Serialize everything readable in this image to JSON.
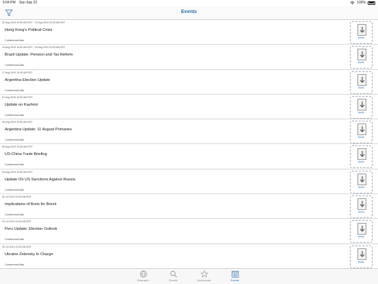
{
  "status": {
    "time": "5:04 PM",
    "date": "Sun Sep 22",
    "battery": "100%"
  },
  "header": {
    "title": "Events"
  },
  "events": [
    {
      "date": "22 Aug 2019 10:00 AM EDT - 22 Aug 2019 10:00 AM EDT",
      "title": "Hong Kong's Political Crisis",
      "category": "ConferenceCalls",
      "audio_label": "Audio"
    },
    {
      "date": "16 Aug 2019 10:00 AM EDT - 16 Aug 2019 10:00 AM EDT",
      "title": "Brazil Update: Pension and Tax Reform",
      "category": "ConferenceCalls",
      "audio_label": "Audio"
    },
    {
      "date": "17 Aug 2019 10:00 AM EDT",
      "title": "Argentina Election Update",
      "category": "ConferenceCalls",
      "audio_label": "Audio"
    },
    {
      "date": "07 Aug 2019 10:00 AM EDT",
      "title": "Update on Kashmir",
      "category": "ConferenceCalls",
      "audio_label": "Audio"
    },
    {
      "date": "05 Aug 2019 10:00 AM EDT",
      "title": "Argentina  Update: 11 August Primaries",
      "category": "ConferenceCalls",
      "audio_label": "Audio"
    },
    {
      "date": "05 Aug 2019 10:00 AM EDT",
      "title": "US-China Trade Briefing",
      "category": "ConferenceCalls",
      "audio_label": "Audio"
    },
    {
      "date": "03 Aug 2019 10:00 AM EDT",
      "title": "Update On US Sanctions Against Russia",
      "category": "ConferenceCalls",
      "audio_label": "Audio"
    },
    {
      "date": "30 Jul 2019 10:00 AM EDT",
      "title": "Implications of Boris for Brexit",
      "category": "ConferenceCalls",
      "audio_label": "Audio"
    },
    {
      "date": "29 Jul 2019 10:00 AM EDT",
      "title": "Peru Update: Election Outlook",
      "category": "ConferenceCalls",
      "audio_label": "Audio"
    },
    {
      "date": "26 Jul 2019 10:00 AM EDT",
      "title": "Ukraine Zelensky In Charge",
      "category": "ConferenceCalls",
      "audio_label": "Audio"
    }
  ],
  "tabs": [
    {
      "label": "Research",
      "icon": "globe-icon"
    },
    {
      "label": "Search",
      "icon": "search-icon"
    },
    {
      "label": "Bookmarks",
      "icon": "star-icon"
    },
    {
      "label": "Events",
      "icon": "calendar-icon"
    }
  ],
  "colors": {
    "accent": "#2b6cb0",
    "separator": "#d6d6d6"
  }
}
